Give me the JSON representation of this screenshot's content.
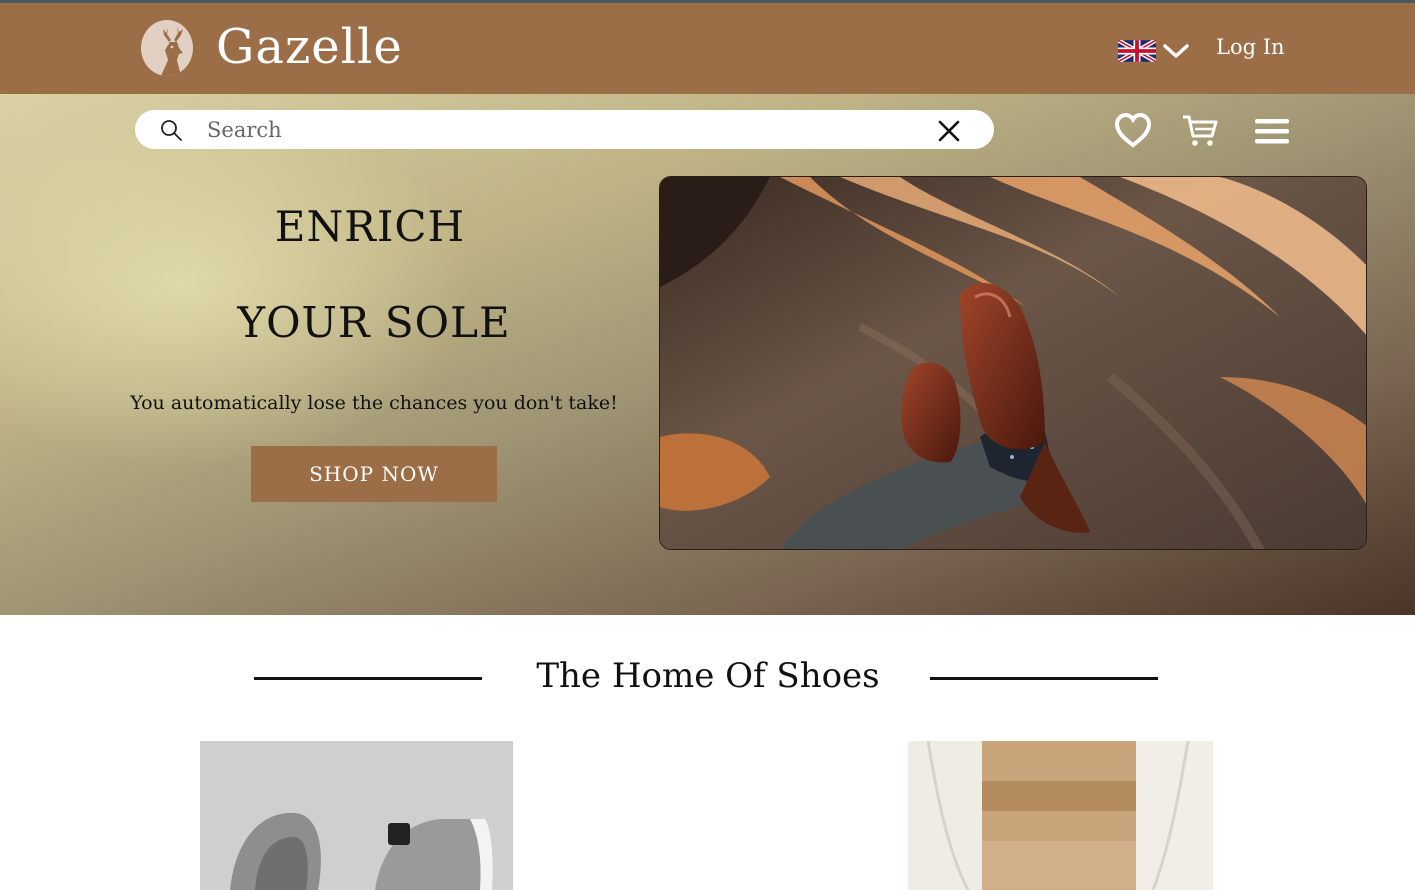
{
  "brand": {
    "name": "Gazelle",
    "logo_icon": "deer-icon"
  },
  "header": {
    "language_icon": "uk-flag-icon",
    "language_dropdown_icon": "chevron-down-icon",
    "login_label": "Log In"
  },
  "search": {
    "placeholder": "Search",
    "value": ""
  },
  "hero": {
    "headline_1": "ENRICH",
    "headline_2": "YOUR SOLE",
    "tagline": "You automatically lose the chances you don't take!",
    "cta_label": "SHOP NOW",
    "image": "legs-crossed-brown-brogues-on-carpet"
  },
  "section": {
    "title": "The Home Of  Shoes"
  },
  "products": [
    {
      "image": "grey-canvas-shoes-on-grey-background"
    },
    {
      "image": "beige-trousers-tan-leather"
    }
  ],
  "colors": {
    "brand_brown": "#9c6e47",
    "header_text": "#ffffff",
    "accent_line": "#4a5a63"
  }
}
